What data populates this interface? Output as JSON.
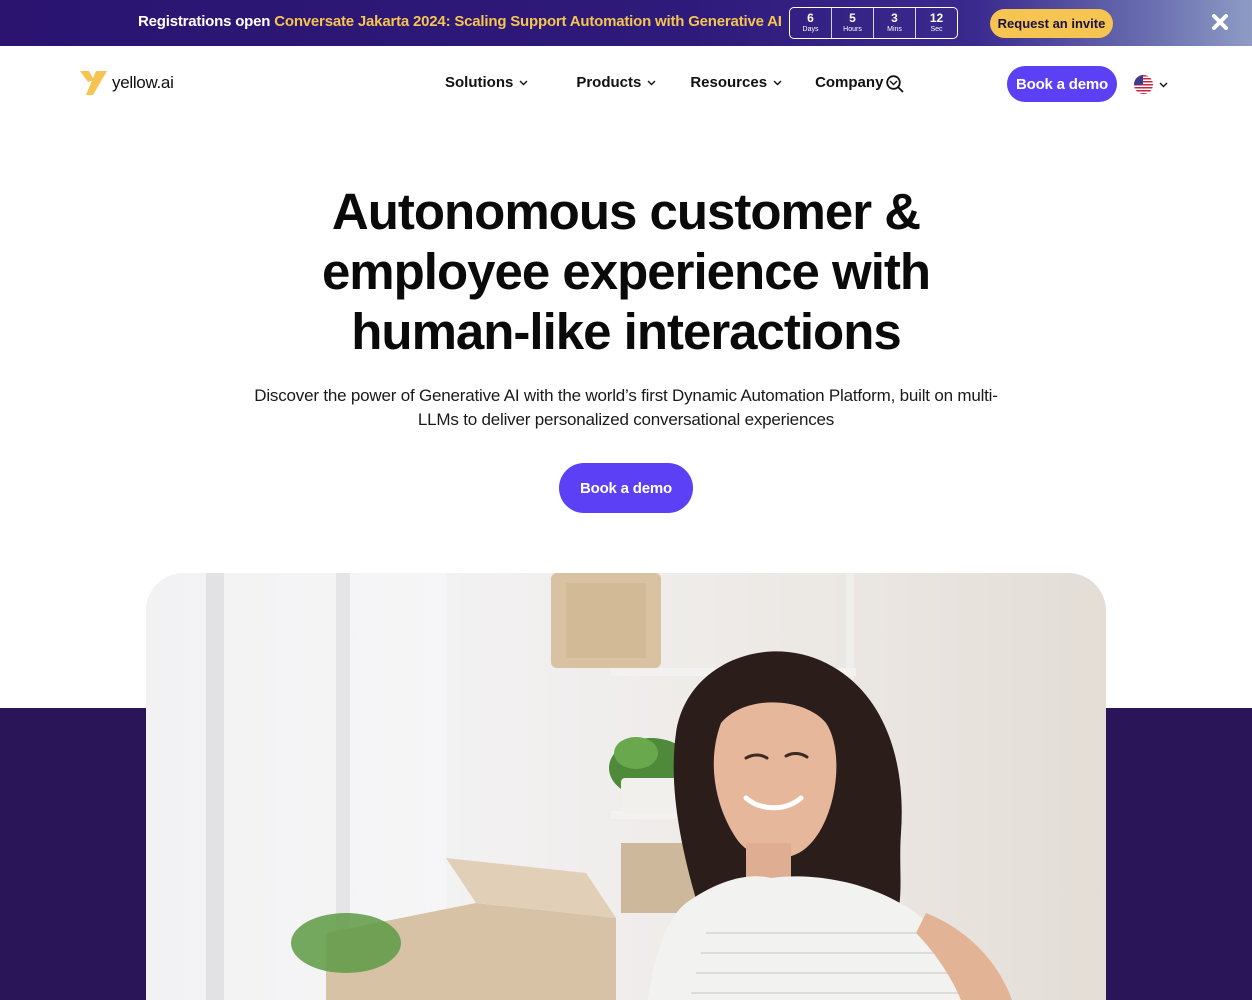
{
  "promo": {
    "prefix": "Registrations open",
    "highlight": "Conversate Jakarta 2024: Scaling Support Automation with Generative AI",
    "countdown": [
      {
        "value": "6",
        "unit": "Days"
      },
      {
        "value": "5",
        "unit": "Hours"
      },
      {
        "value": "3",
        "unit": "Mins"
      },
      {
        "value": "12",
        "unit": "Sec"
      }
    ],
    "cta": "Request an invite",
    "close_icon": "close-icon"
  },
  "header": {
    "logo_text": "yellow.ai",
    "menu": [
      {
        "label": "Solutions"
      },
      {
        "label": "Products"
      },
      {
        "label": "Resources"
      },
      {
        "label": "Company"
      }
    ],
    "search_icon": "search-icon",
    "cta": "Book a demo",
    "language_icon": "us-flag-icon"
  },
  "hero": {
    "title_lines": [
      "Autonomous customer &",
      "employee experience with",
      "human-like interactions"
    ],
    "subtitle_lines": [
      "Discover the power of Generative AI with the world’s first Dynamic Automation Platform, built on multi-",
      "LLMs to deliver personalized conversational experiences"
    ],
    "cta": "Book a demo"
  },
  "colors": {
    "brand_purple": "#5b40f5",
    "promo_bg": "#2a1470",
    "highlight_yellow": "#f5c451",
    "band_bg": "#2a1559"
  }
}
